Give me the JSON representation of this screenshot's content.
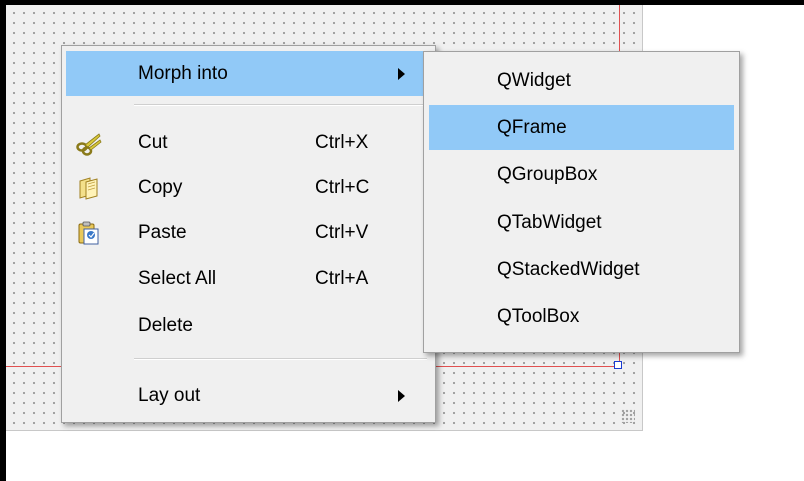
{
  "main_menu": {
    "items": [
      {
        "label": "Morph into",
        "icon": "",
        "shortcut": "",
        "submenu": true,
        "highlighted": true
      },
      {
        "label": "Cut",
        "icon": "scissors-icon",
        "shortcut": "Ctrl+X"
      },
      {
        "label": "Copy",
        "icon": "copy-icon",
        "shortcut": "Ctrl+C"
      },
      {
        "label": "Paste",
        "icon": "paste-icon",
        "shortcut": "Ctrl+V"
      },
      {
        "label": "Select All",
        "icon": "",
        "shortcut": "Ctrl+A"
      },
      {
        "label": "Delete",
        "icon": "",
        "shortcut": ""
      },
      {
        "label": "Lay out",
        "icon": "",
        "shortcut": "",
        "submenu": true
      }
    ]
  },
  "sub_menu": {
    "items": [
      {
        "label": "QWidget"
      },
      {
        "label": "QFrame",
        "highlighted": true
      },
      {
        "label": "QGroupBox"
      },
      {
        "label": "QTabWidget"
      },
      {
        "label": "QStackedWidget"
      },
      {
        "label": "QToolBox"
      }
    ]
  },
  "colors": {
    "highlight": "#91c9f7",
    "menu_background": "#f0f0f0",
    "guide_line": "#e05050",
    "selection_handle": "#1a3bd1"
  }
}
